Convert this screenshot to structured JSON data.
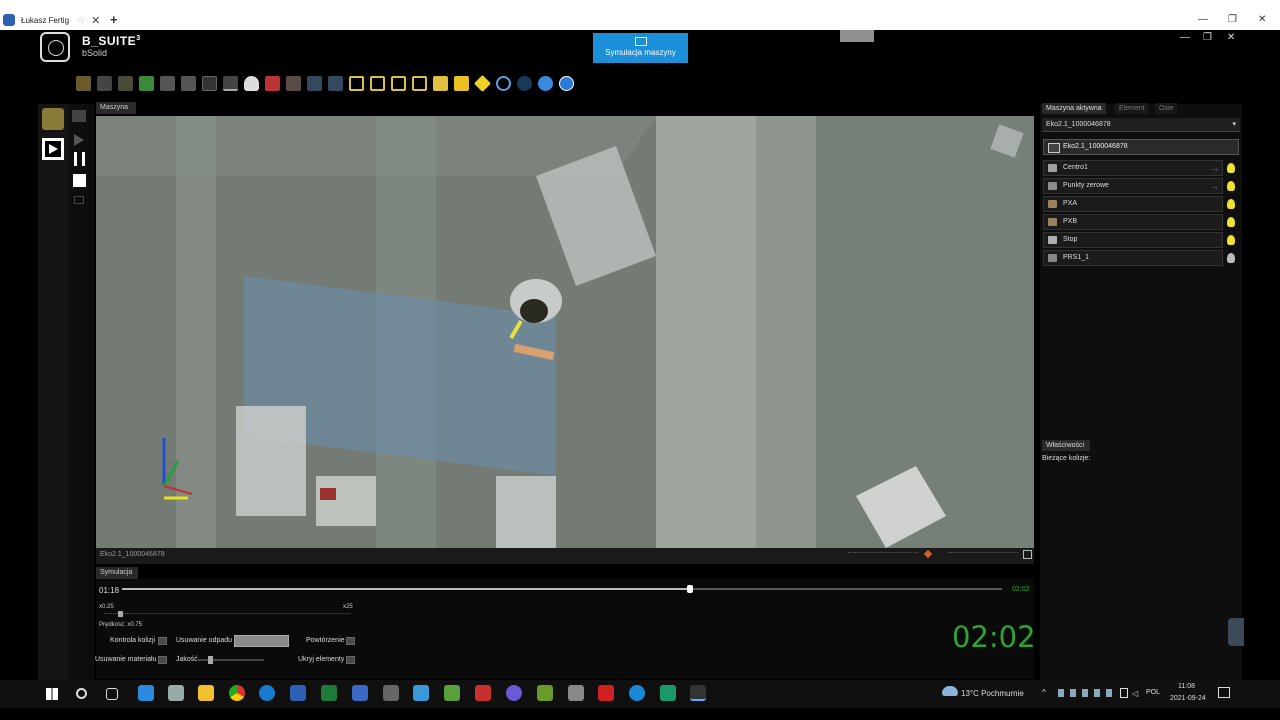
{
  "browser": {
    "tab_title": "Łukasz Fertig",
    "tab_star": "☆",
    "tab_close": "✕",
    "new_tab": "+",
    "minimize": "—",
    "restore": "❐",
    "close": "✕"
  },
  "app": {
    "brand": "B_SUITE",
    "brand_sup": "3",
    "brand_sub": "bSolid",
    "mode_button": "Symulacja maszyny",
    "window_minimize": "—",
    "window_restore": "❐",
    "window_close": "✕"
  },
  "viewport": {
    "tab": "Maszyna",
    "status_label": "Eko2.1_1000046878"
  },
  "simulation": {
    "tab": "Symulacja",
    "current_time": "01:18",
    "end_time": "02:02",
    "progress_fraction": 0.645,
    "speed_min": "x0.25",
    "speed_max": "x25",
    "speed_label": "Prędkość: x0.75",
    "big_time": "02:02",
    "options": {
      "collision_control": "Kontrola kolizji",
      "waste_removal": "Usuwanie odpadu",
      "repetition": "Powtórzenie",
      "material_removal": "Usuwanie materiału",
      "quality": "Jakość",
      "hide_elements": "Ukryj elementy"
    }
  },
  "right_panel": {
    "tabs": [
      "Maszyna aktywna",
      "Element",
      "Osie"
    ],
    "machine_select": "Eko2.1_1000046878",
    "root_item": "Eko2.1_1000046878",
    "items": [
      {
        "label": "Centro1",
        "icon": "machine-icon",
        "arrow": true,
        "bulb": "on"
      },
      {
        "label": "Punkty zerowe",
        "icon": "origin-icon",
        "arrow": true,
        "bulb": "on"
      },
      {
        "label": "PXA",
        "icon": "bracket-icon",
        "arrow": false,
        "bulb": "on"
      },
      {
        "label": "PXB",
        "icon": "bracket-icon",
        "arrow": false,
        "bulb": "on"
      },
      {
        "label": "Stop",
        "icon": "stop-pin-icon",
        "arrow": false,
        "bulb": "on"
      },
      {
        "label": "PRS1_1",
        "icon": "tool-icon",
        "arrow": false,
        "bulb": "off"
      }
    ],
    "properties_tab": "Właściwości",
    "collisions_label": "Bieżące kolizje:"
  },
  "taskbar": {
    "weather": "13°C  Pochmurnie",
    "lang": "POL",
    "time": "11:08",
    "date": "2021-09-24"
  }
}
